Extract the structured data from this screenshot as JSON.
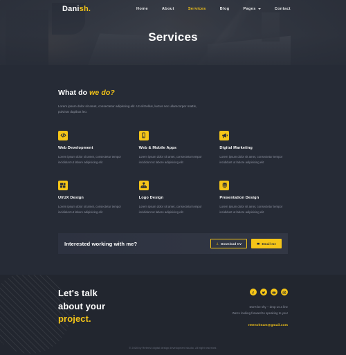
{
  "nav": {
    "logo_main": "Dani",
    "logo_accent": "sh.",
    "items": [
      {
        "label": "Home",
        "active": false,
        "caret": false
      },
      {
        "label": "About",
        "active": false,
        "caret": false
      },
      {
        "label": "Services",
        "active": true,
        "caret": false
      },
      {
        "label": "Blog",
        "active": false,
        "caret": false
      },
      {
        "label": "Pages",
        "active": false,
        "caret": true
      },
      {
        "label": "Contact",
        "active": false,
        "caret": false
      }
    ]
  },
  "hero": {
    "title": "Services"
  },
  "section": {
    "title_plain": "What do ",
    "title_accent": "we do?",
    "description": "Lorem ipsum dolor sit amet, consectetur adipiscing elit. Ut elit tellus, luctus nec ullamcorper mattis, pulvinar dapibus leo."
  },
  "services": [
    {
      "icon": "code-icon",
      "title": "Web Development",
      "description": "Lorem ipsum dolor sit amet, consectetur tempor incididunt ut labore adipisicing elit"
    },
    {
      "icon": "mobile-icon",
      "title": "Web & Mobile Apps",
      "description": "Lorem ipsum dolor sit amet, consectetur tempor incididunt ut labore adipisicing elit"
    },
    {
      "icon": "megaphone-icon",
      "title": "Digital Marketing",
      "description": "Lorem ipsum dolor sit amet, consectetur tempor incididunt ut labore adipisicing elit"
    },
    {
      "icon": "layout-icon",
      "title": "UI/UX Design",
      "description": "Lorem ipsum dolor sit amet, consectetur tempor incididunt ut labore adipisicing elit"
    },
    {
      "icon": "sitemap-icon",
      "title": "Logo Design",
      "description": "Lorem ipsum dolor sit amet, consectetur tempor incididunt ut labore adipisicing elit"
    },
    {
      "icon": "presentation-icon",
      "title": "Presentation Design",
      "description": "Lorem ipsum dolor sit amet, consectetur tempor incididunt ut labore adipisicing elit"
    }
  ],
  "cta": {
    "heading": "Interested working with me?",
    "download_label": "Download CV",
    "email_label": "Email me"
  },
  "footer": {
    "talk_line1": "Let's talk",
    "talk_line2": "about your",
    "talk_line3": "project.",
    "socials": [
      {
        "name": "facebook-icon"
      },
      {
        "name": "twitter-icon"
      },
      {
        "name": "youtube-icon"
      },
      {
        "name": "instagram-icon"
      }
    ],
    "tagline1": "Don't be shy – drop us a line",
    "tagline2": "We're looking forward to speaking to you!",
    "email": "retenviteam@gmail.com",
    "copyright": "© 2020 by Retenvi digital design development studio. All right reserved."
  },
  "colors": {
    "accent": "#f5c518",
    "background": "#262b36",
    "footer_background": "#22262f",
    "muted_text": "#8d92a0"
  }
}
